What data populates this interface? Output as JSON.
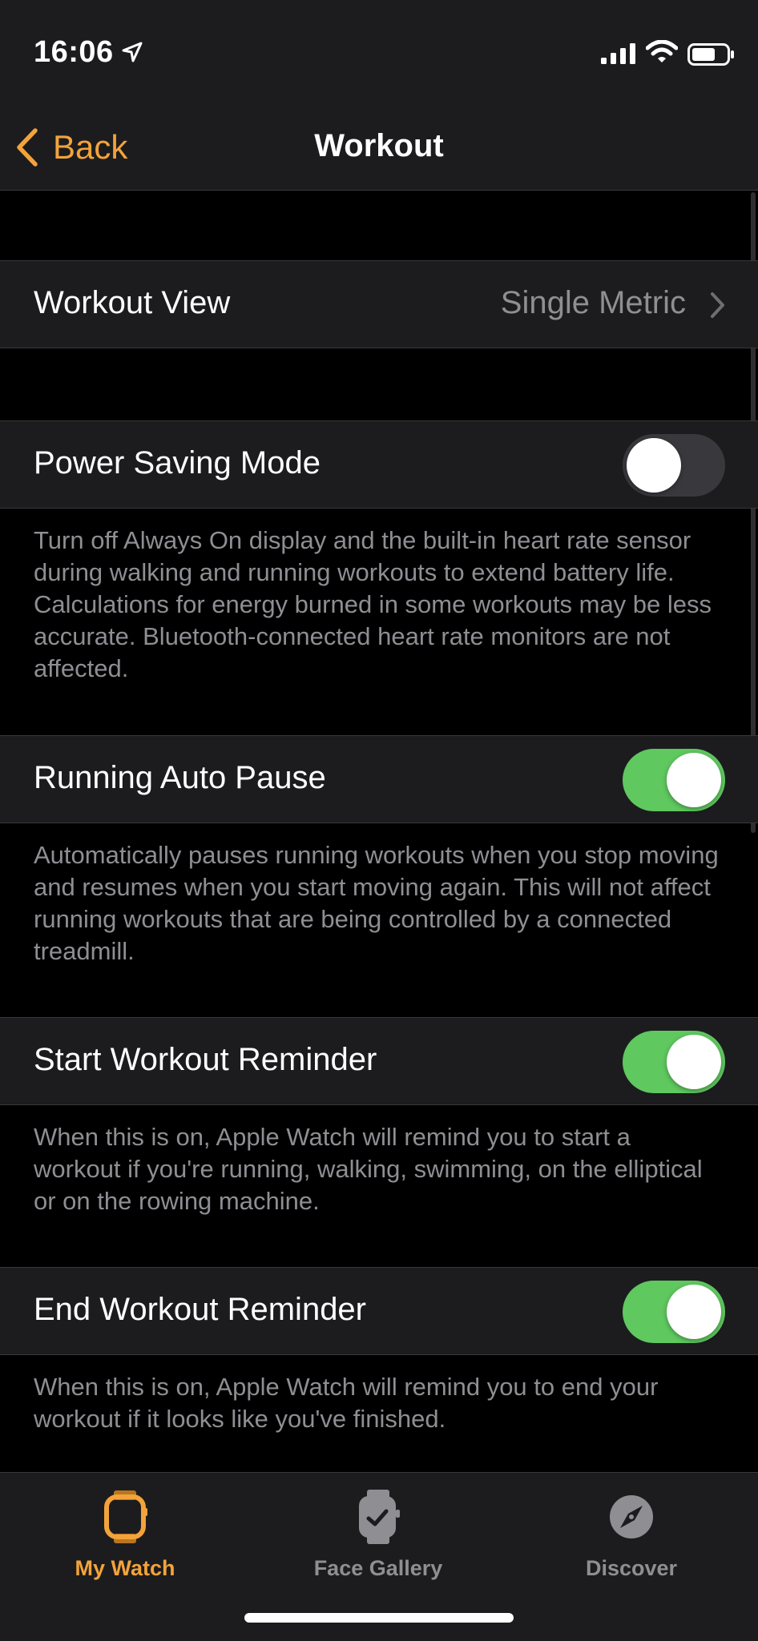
{
  "status": {
    "time": "16:06"
  },
  "nav": {
    "back_label": "Back",
    "title": "Workout"
  },
  "settings": {
    "workout_view": {
      "label": "Workout View",
      "value": "Single Metric"
    },
    "power_saving": {
      "label": "Power Saving Mode",
      "enabled": false,
      "footnote": "Turn off Always On display and the built-in heart rate sensor during walking and running workouts to extend battery life. Calculations for energy burned in some workouts may be less accurate. Bluetooth-connected heart rate monitors are not affected."
    },
    "running_auto_pause": {
      "label": "Running Auto Pause",
      "enabled": true,
      "footnote": "Automatically pauses running workouts when you stop moving and resumes when you start moving again. This will not affect running workouts that are being controlled by a connected treadmill."
    },
    "start_reminder": {
      "label": "Start Workout Reminder",
      "enabled": true,
      "footnote": "When this is on, Apple Watch will remind you to start a workout if you're running, walking, swimming, on the elliptical or on the rowing machine."
    },
    "end_reminder": {
      "label": "End Workout Reminder",
      "enabled": true,
      "footnote": "When this is on, Apple Watch will remind you to end your workout if it looks like you've finished."
    }
  },
  "tabs": [
    {
      "label": "My Watch",
      "icon": "watch-icon",
      "active": true
    },
    {
      "label": "Face Gallery",
      "icon": "face-gallery-icon",
      "active": false
    },
    {
      "label": "Discover",
      "icon": "compass-icon",
      "active": false
    }
  ],
  "colors": {
    "accent": "#f3a33a",
    "toggle_on": "#5fc85f",
    "toggle_off": "#39393d",
    "cell_background": "#1c1c1e",
    "secondary_text": "#8e8e93"
  }
}
